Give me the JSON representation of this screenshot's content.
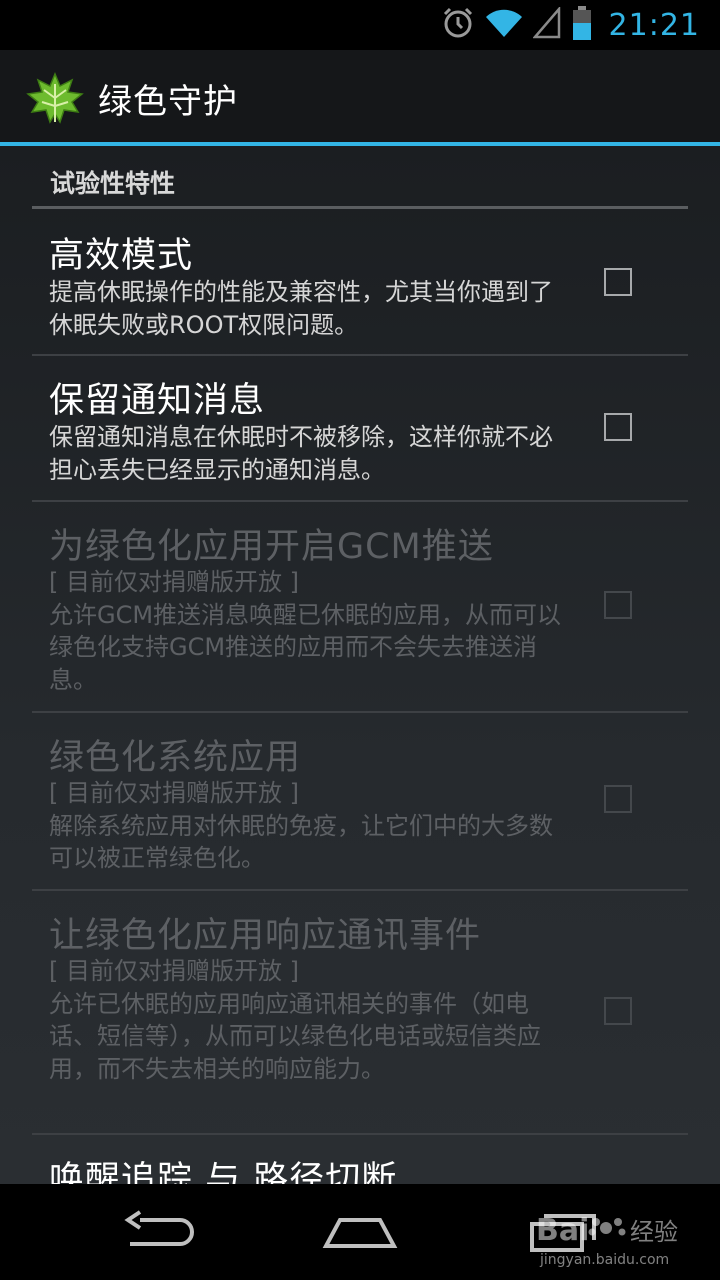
{
  "status_bar": {
    "time": "21:21",
    "icons": [
      "alarm-icon",
      "wifi-icon",
      "signal-icon",
      "battery-icon"
    ]
  },
  "action_bar": {
    "title": "绿色守护",
    "logo_icon": "leaf-icon"
  },
  "category": {
    "title": "试验性特性"
  },
  "preferences": [
    {
      "title": "高效模式",
      "summary": "提高休眠操作的性能及兼容性，尤其当你遇到了休眠失败或ROOT权限问题。",
      "enabled": true,
      "checked": false
    },
    {
      "title": "保留通知消息",
      "summary": "保留通知消息在休眠时不被移除，这样你就不必担心丢失已经显示的通知消息。",
      "enabled": true,
      "checked": false
    },
    {
      "title": "为绿色化应用开启GCM推送",
      "summary": "[ 目前仅对捐赠版开放 ]\n允许GCM推送消息唤醒已休眠的应用，从而可以绿色化支持GCM推送的应用而不会失去推送消息。",
      "enabled": false,
      "checked": false
    },
    {
      "title": "绿色化系统应用",
      "summary": "[ 目前仅对捐赠版开放 ]\n解除系统应用对休眠的免疫，让它们中的大多数可以被正常绿色化。",
      "enabled": false,
      "checked": false
    },
    {
      "title": "让绿色化应用响应通讯事件",
      "summary": "[ 目前仅对捐赠版开放 ]\n允许已休眠的应用响应通讯相关的事件（如电话、短信等），从而可以绿色化电话或短信类应用，而不失去相关的响应能力。",
      "enabled": false,
      "checked": false
    },
    {
      "title": "唤醒追踪 与 路径切断",
      "summary": "",
      "enabled": true,
      "checked": false
    }
  ],
  "nav_bar": {
    "buttons": [
      "back-icon",
      "home-icon",
      "recents-icon"
    ]
  },
  "watermark": {
    "brand": "Bai",
    "brand_suffix": "经验",
    "url": "jingyan.baidu.com"
  },
  "colors": {
    "accent": "#33b5e5",
    "background": "#1b1e21",
    "disabled_text": "#5d6064"
  }
}
